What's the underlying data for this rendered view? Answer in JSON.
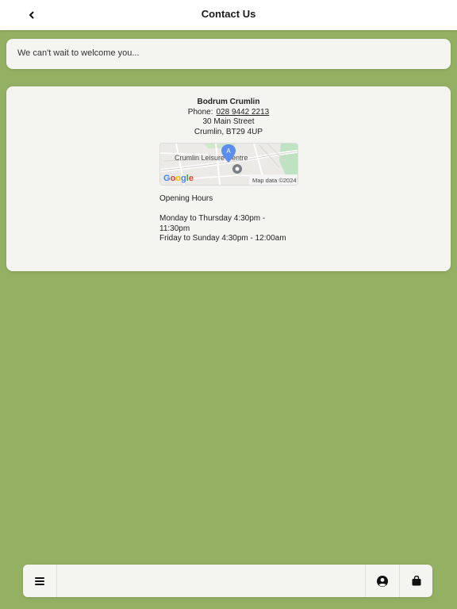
{
  "header": {
    "title": "Contact Us",
    "back_icon": "chevron-left-icon"
  },
  "welcome": {
    "message": "We can't wait to welcome you..."
  },
  "venue": {
    "name": "Bodrum Crumlin",
    "phone_label": "Phone:",
    "phone": "028 9442 2213",
    "address_line1": "30 Main Street",
    "address_line2": "Crumlin, BT29 4UP",
    "map": {
      "place_label": "Crumlin Leisure Centre",
      "marker_label": "A",
      "attribution": "Map data ©2024",
      "brand": "Google"
    }
  },
  "hours": {
    "heading": "Opening Hours",
    "line1": "Monday to Thursday 4:30pm - 11:30pm",
    "line2": "Friday to Sunday 4:30pm - 12:00am"
  },
  "bottom_nav": {
    "menu_icon": "hamburger-menu-icon",
    "account_icon": "user-circle-icon",
    "cart_icon": "shopping-bag-icon"
  },
  "colors": {
    "background": "#94b063",
    "card": "#f4f4f0",
    "map_marker": "#5b8def"
  }
}
